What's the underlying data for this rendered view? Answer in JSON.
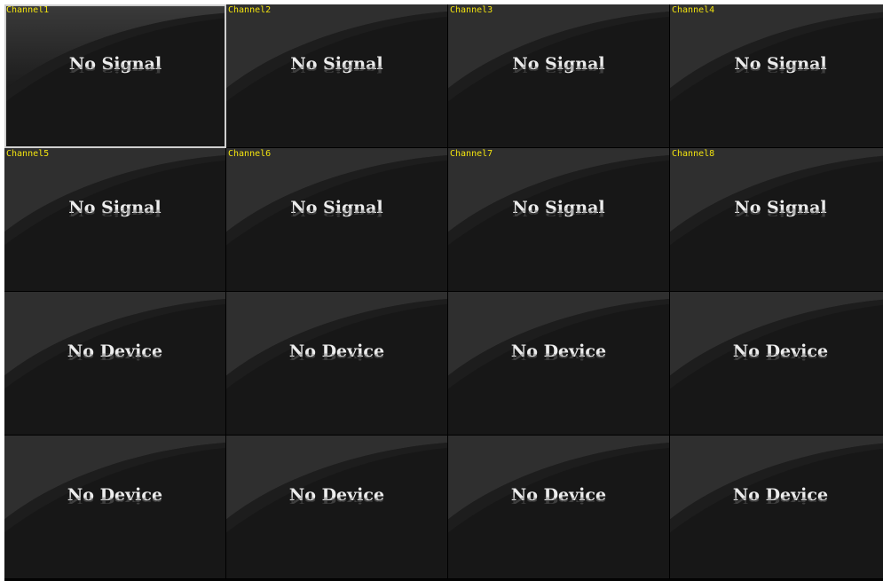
{
  "colors": {
    "label": "#f2e30f",
    "status_text": "#ececec",
    "tile_bg": "#171717",
    "selected_border": "#cfcfcf"
  },
  "cells": [
    {
      "label": "Channel1",
      "status": "No Signal",
      "selected": true
    },
    {
      "label": "Channel2",
      "status": "No Signal"
    },
    {
      "label": "Channel3",
      "status": "No Signal"
    },
    {
      "label": "Channel4",
      "status": "No Signal"
    },
    {
      "label": "Channel5",
      "status": "No Signal"
    },
    {
      "label": "Channel6",
      "status": "No Signal"
    },
    {
      "label": "Channel7",
      "status": "No Signal"
    },
    {
      "label": "Channel8",
      "status": "No Signal"
    },
    {
      "label": "",
      "status": "No Device"
    },
    {
      "label": "",
      "status": "No Device"
    },
    {
      "label": "",
      "status": "No Device"
    },
    {
      "label": "",
      "status": "No Device"
    },
    {
      "label": "",
      "status": "No Device"
    },
    {
      "label": "",
      "status": "No Device"
    },
    {
      "label": "",
      "status": "No Device"
    },
    {
      "label": "",
      "status": "No Device"
    }
  ]
}
